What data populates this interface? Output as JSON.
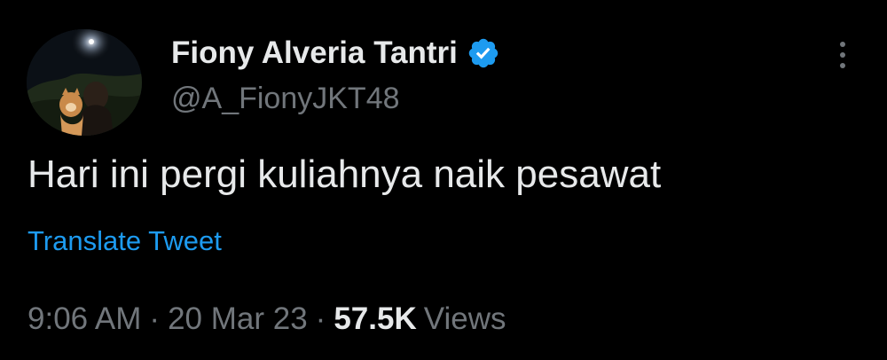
{
  "author": {
    "display_name": "Fiony Alveria Tantri",
    "handle": "@A_FionyJKT48",
    "verified": true
  },
  "tweet": {
    "text": "Hari ini pergi kuliahnya naik pesawat",
    "translate_label": "Translate Tweet",
    "time": "9:06 AM",
    "date": "20 Mar 23",
    "separator": "·",
    "views_count": "57.5K",
    "views_label": "Views"
  },
  "colors": {
    "background": "#000000",
    "primary_text": "#e7e9ea",
    "secondary_text": "#71767b",
    "link": "#1d9bf0",
    "verified_badge": "#1d9bf0"
  },
  "icons": {
    "verified": "verified-badge-icon",
    "more": "more-options-icon"
  }
}
